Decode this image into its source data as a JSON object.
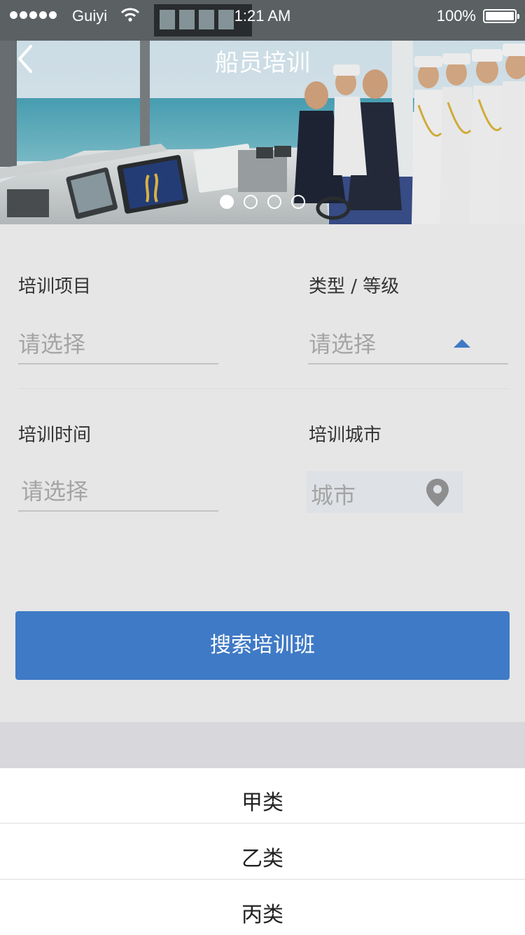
{
  "status_bar": {
    "carrier": "Guiyi",
    "time": "1:21 AM",
    "battery": "100%"
  },
  "nav": {
    "title": "船员培训"
  },
  "banner": {
    "page_count": 4,
    "active_page": 1
  },
  "form": {
    "training_item": {
      "label": "培训项目",
      "placeholder": "请选择"
    },
    "type_level": {
      "label": "类型 / 等级",
      "placeholder": "请选择"
    },
    "training_time": {
      "label": "培训时间",
      "placeholder": "请选择"
    },
    "training_city": {
      "label": "培训城市",
      "placeholder": "城市"
    }
  },
  "search_button": "搜索培训班",
  "picker": {
    "options": [
      "甲类",
      "乙类",
      "丙类"
    ]
  },
  "colors": {
    "accent": "#3f7ac6",
    "page_bg": "#e6e6e6",
    "placeholder": "#a4a4a4"
  },
  "icons": [
    "back-chevron-icon",
    "wifi-icon",
    "battery-icon",
    "location-pin-icon",
    "caret-up-icon"
  ]
}
